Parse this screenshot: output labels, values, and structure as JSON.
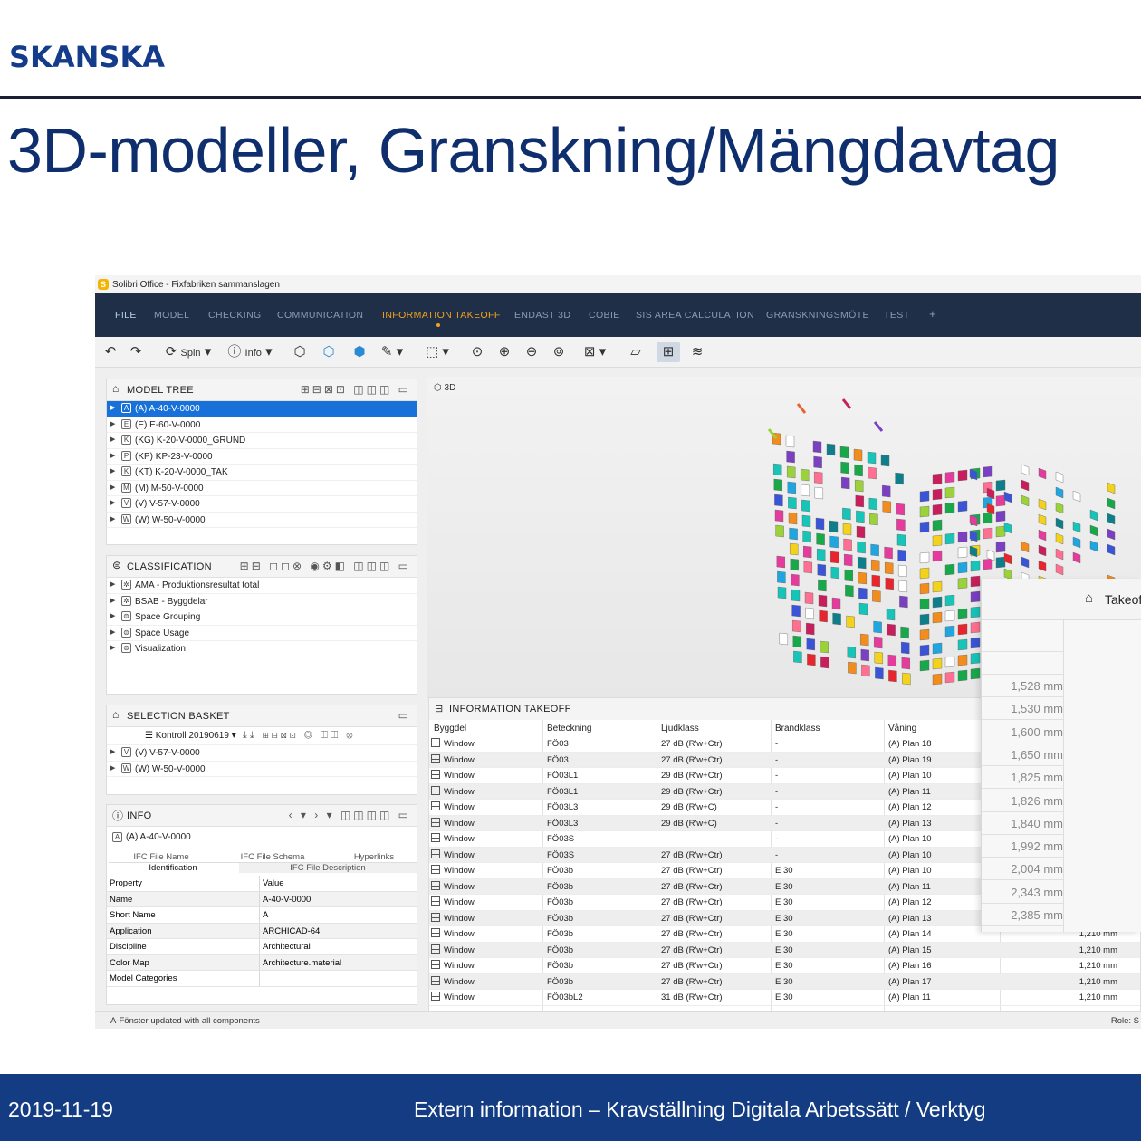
{
  "slide": {
    "logo": "SKANSKA",
    "title": "3D-modeller, Granskning/Mängdavtag",
    "footer_date": "2019-11-19",
    "footer_text": "Extern information – Kravställning Digitala Arbetssätt / Verktyg"
  },
  "app": {
    "window_title": "Solibri Office - Fixfabriken sammanslagen",
    "menu": [
      "FILE",
      "MODEL",
      "CHECKING",
      "COMMUNICATION",
      "INFORMATION TAKEOFF",
      "ENDAST 3D",
      "COBIE",
      "SIS AREA CALCULATION",
      "GRANSKNINGSMÖTE",
      "TEST",
      "+"
    ],
    "active_menu": "INFORMATION TAKEOFF",
    "toolbar": {
      "spin_label": "Spin",
      "info_label": "Info"
    },
    "model_tree": {
      "title": "MODEL TREE",
      "items": [
        {
          "label": "(A) A-40-V-0000",
          "icon": "A",
          "selected": true
        },
        {
          "label": "(E) E-60-V-0000",
          "icon": "E"
        },
        {
          "label": "(KG) K-20-V-0000_GRUND",
          "icon": "K"
        },
        {
          "label": "(KP) KP-23-V-0000",
          "icon": "P"
        },
        {
          "label": "(KT) K-20-V-0000_TAK",
          "icon": "K"
        },
        {
          "label": "(M) M-50-V-0000",
          "icon": "M"
        },
        {
          "label": "(V) V-57-V-0000",
          "icon": "V"
        },
        {
          "label": "(W) W-50-V-0000",
          "icon": "W"
        }
      ]
    },
    "classification": {
      "title": "CLASSIFICATION",
      "items": [
        "AMA - Produktionsresultat total",
        "BSAB - Byggdelar",
        "Space Grouping",
        "Space Usage",
        "Visualization"
      ]
    },
    "selection_basket": {
      "title": "SELECTION BASKET",
      "dropdown": "Kontroll 20190619",
      "items": [
        "(V) V-57-V-0000",
        "(W) W-50-V-0000"
      ]
    },
    "info": {
      "title": "INFO",
      "object": "(A) A-40-V-0000",
      "tabs_top": [
        "IFC File Name",
        "IFC File Schema",
        "Hyperlinks"
      ],
      "tabs_bottom": [
        "Identification",
        "IFC File Description"
      ],
      "columns": [
        "Property",
        "Value"
      ],
      "rows": [
        [
          "Name",
          "A-40-V-0000"
        ],
        [
          "Short Name",
          "A"
        ],
        [
          "Application",
          "ARCHICAD-64"
        ],
        [
          "Discipline",
          "Architectural"
        ],
        [
          "Color Map",
          "Architecture.material"
        ],
        [
          "Model Categories",
          ""
        ]
      ]
    },
    "view3d_label": "3D",
    "takeoff": {
      "title": "INFORMATION TAKEOFF",
      "columns": [
        "Byggdel",
        "Beteckning",
        "Ljudklass",
        "Brandklass",
        "Våning"
      ],
      "rows": [
        [
          "Window",
          "FÖ03",
          "27 dB (R'w+Ctr)",
          "-",
          "(A) Plan 18",
          ""
        ],
        [
          "Window",
          "FÖ03",
          "27 dB (R'w+Ctr)",
          "-",
          "(A) Plan 19",
          ""
        ],
        [
          "Window",
          "FÖ03L1",
          "29 dB (R'w+Ctr)",
          "-",
          "(A) Plan 10",
          ""
        ],
        [
          "Window",
          "FÖ03L1",
          "29 dB (R'w+Ctr)",
          "-",
          "(A) Plan 11",
          ""
        ],
        [
          "Window",
          "FÖ03L3",
          "29 dB (R'w+C)",
          "-",
          "(A) Plan 12",
          ""
        ],
        [
          "Window",
          "FÖ03L3",
          "29 dB (R'w+C)",
          "-",
          "(A) Plan 13",
          ""
        ],
        [
          "Window",
          "FÖ03S",
          "",
          "-",
          "(A) Plan 10",
          ""
        ],
        [
          "Window",
          "FÖ03S",
          "27 dB (R'w+Ctr)",
          "-",
          "(A) Plan 10",
          ""
        ],
        [
          "Window",
          "FÖ03b",
          "27 dB (R'w+Ctr)",
          "E 30",
          "(A) Plan 10",
          ""
        ],
        [
          "Window",
          "FÖ03b",
          "27 dB (R'w+Ctr)",
          "E 30",
          "(A) Plan 11",
          ""
        ],
        [
          "Window",
          "FÖ03b",
          "27 dB (R'w+Ctr)",
          "E 30",
          "(A) Plan 12",
          ""
        ],
        [
          "Window",
          "FÖ03b",
          "27 dB (R'w+Ctr)",
          "E 30",
          "(A) Plan 13",
          ""
        ],
        [
          "Window",
          "FÖ03b",
          "27 dB (R'w+Ctr)",
          "E 30",
          "(A) Plan 14",
          "1,210 mm"
        ],
        [
          "Window",
          "FÖ03b",
          "27 dB (R'w+Ctr)",
          "E 30",
          "(A) Plan 15",
          "1,210 mm"
        ],
        [
          "Window",
          "FÖ03b",
          "27 dB (R'w+Ctr)",
          "E 30",
          "(A) Plan 16",
          "1,210 mm"
        ],
        [
          "Window",
          "FÖ03b",
          "27 dB (R'w+Ctr)",
          "E 30",
          "(A) Plan 17",
          "1,210 mm"
        ],
        [
          "Window",
          "FÖ03bL2",
          "31 dB (R'w+Ctr)",
          "E 30",
          "(A) Plan 11",
          "1,210 mm"
        ]
      ]
    },
    "overlay": {
      "title": "Takeof",
      "values": [
        "1,528 mm",
        "1,530 mm",
        "1,600 mm",
        "1,650 mm",
        "1,825 mm",
        "1,826 mm",
        "1,840 mm",
        "1,992 mm",
        "2,004 mm",
        "2,343 mm",
        "2,385 mm"
      ]
    },
    "status_left": "A-Fönster updated with all components",
    "status_right": "Role: S"
  }
}
